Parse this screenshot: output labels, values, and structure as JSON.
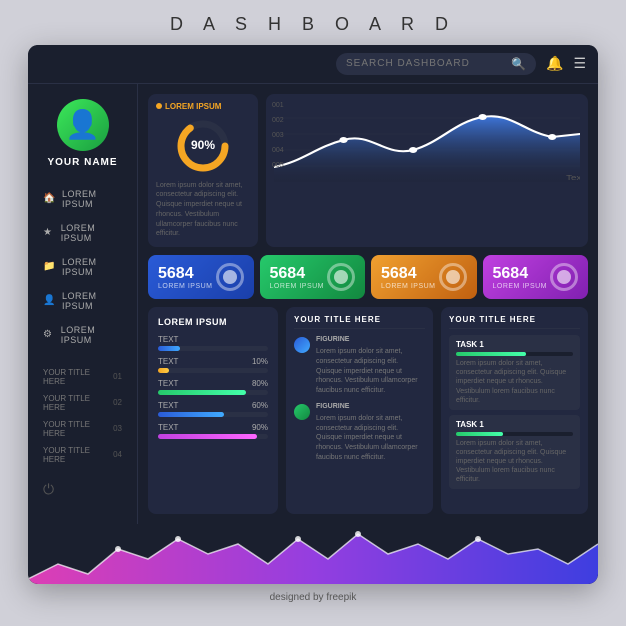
{
  "page": {
    "title": "D A S H B O A R D",
    "footer": "designed by  freepik"
  },
  "header": {
    "search_placeholder": "SEARCH DASHBOARD"
  },
  "sidebar": {
    "user_name": "YOUR NAME",
    "nav_items": [
      {
        "icon": "🏠",
        "label": "LOREM IPSUM"
      },
      {
        "icon": "★",
        "label": "LOREM IPSUM"
      },
      {
        "icon": "📁",
        "label": "LOREM IPSUM"
      },
      {
        "icon": "👤",
        "label": "LOREM IPSUM"
      },
      {
        "icon": "⚙",
        "label": "LOREM IPSUM"
      }
    ],
    "links": [
      {
        "label": "YOUR TITLE HERE",
        "num": "01"
      },
      {
        "label": "YOUR TITLE HERE",
        "num": "02"
      },
      {
        "label": "YOUR TITLE HERE",
        "num": "03"
      },
      {
        "label": "YOUR TITLE HERE",
        "num": "04"
      }
    ]
  },
  "donut_widget": {
    "label": "LOREM IPSUM",
    "value": "90%",
    "percent": 90,
    "description": "Lorem ipsum dolor sit amet, consectetur adipiscing elit. Quisque imperdiet neque ut rhoncus. Vestibulum ullamcorper faucibus nunc efficitur."
  },
  "chart": {
    "y_labels": [
      "001",
      "002",
      "003",
      "004",
      "005"
    ]
  },
  "stats": [
    {
      "number": "5684",
      "label": "LOREM IPSUM",
      "gradient": "blue"
    },
    {
      "number": "5684",
      "label": "LOREM IPSUM",
      "gradient": "green"
    },
    {
      "number": "5684",
      "label": "LOREM IPSUM",
      "gradient": "orange"
    },
    {
      "number": "5684",
      "label": "LOREM IPSUM",
      "gradient": "purple"
    }
  ],
  "progress_widget": {
    "title": "LOREM IPSUM",
    "items": [
      {
        "label": "TEXT",
        "percent": 20,
        "color": "blue"
      },
      {
        "label": "TEXT",
        "percent": 10,
        "width": "10%"
      },
      {
        "label": "TEXT",
        "percent": 80,
        "color": "orange"
      },
      {
        "label": "TEXT",
        "percent": 60,
        "color": "green"
      },
      {
        "label": "TEXT",
        "percent": 90,
        "color": "purple"
      }
    ]
  },
  "info_panel_1": {
    "title": "YOUR TITLE HERE",
    "blocks": [
      {
        "dot_color": "blue",
        "label": "FIGURINE",
        "text": "Lorem ipsum dolor sit amet, consectetur adipiscing elit. Quisque imperdiet neque ut rhoncus. Vestibulum ullamcorper faucibus nunc efficitur."
      },
      {
        "dot_color": "green",
        "label": "FIGURINE",
        "text": "Lorem ipsum dolor sit amet, consectetur adipiscing elit. Quisque imperdiet neque ut rhoncus. Vestibulum ullamcorper faucibus nunc efficitur."
      }
    ]
  },
  "tasks_panel": {
    "title": "YOUR TITLE HERE",
    "tasks": [
      {
        "title": "TASK 1",
        "desc": "Lorem ipsum dolor sit amet, consectetur adipiscing elit. Quisque imperdiet neque ut rhoncus. Vestibulum lorem faucibus nunc efficitur."
      },
      {
        "title": "TASK 1",
        "desc": "Lorem ipsum dolor sit amet, consectetur adipiscing elit. Quisque imperdiet neque ut rhoncus. Vestibulum lorem faucibus nunc efficitur."
      }
    ]
  }
}
